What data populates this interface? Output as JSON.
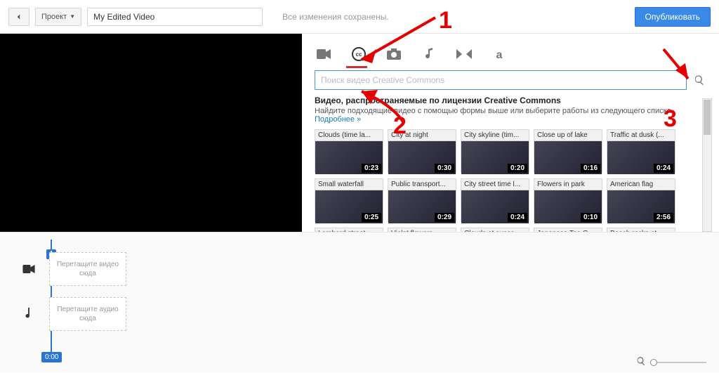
{
  "topbar": {
    "project_label": "Проект",
    "title_value": "My Edited Video",
    "status": "Все изменения сохранены.",
    "publish": "Опубликовать"
  },
  "tabs": {
    "active_index": 1,
    "items": [
      "camera-icon",
      "cc-icon",
      "photo-icon",
      "music-icon",
      "transition-icon",
      "text-icon"
    ]
  },
  "search": {
    "placeholder": "Поиск видео Creative Commons"
  },
  "cc": {
    "heading": "Видео, распространяемые по лицензии Creative Commons",
    "sub": "Найдите подходящие видео с помощью формы выше или выберите работы из следующего списка.",
    "more": "Подробнее »"
  },
  "clips": {
    "row1": [
      {
        "title": "Clouds (time la...",
        "dur": "0:23"
      },
      {
        "title": "City at night",
        "dur": "0:30"
      },
      {
        "title": "City skyline (tim...",
        "dur": "0:20"
      },
      {
        "title": "Close up of lake",
        "dur": "0:16"
      },
      {
        "title": "Traffic at dusk (...",
        "dur": "0:24"
      }
    ],
    "row2": [
      {
        "title": "Small waterfall",
        "dur": "0:25"
      },
      {
        "title": "Public transport...",
        "dur": "0:29"
      },
      {
        "title": "City street time l...",
        "dur": "0:24"
      },
      {
        "title": "Flowers in park",
        "dur": "0:10"
      },
      {
        "title": "American flag",
        "dur": "2:56"
      }
    ],
    "row3": [
      {
        "title": "Lombard street"
      },
      {
        "title": "Violet flowers"
      },
      {
        "title": "Clouds at sunse..."
      },
      {
        "title": "Japanese Tea G..."
      },
      {
        "title": "Beach rocks at ..."
      }
    ]
  },
  "timeline": {
    "video_hint": "Перетащите видео сюда",
    "audio_hint": "Перетащите аудио сюда",
    "playhead": "0:00"
  },
  "annotations": {
    "n1": "1",
    "n2": "2",
    "n3": "3"
  }
}
